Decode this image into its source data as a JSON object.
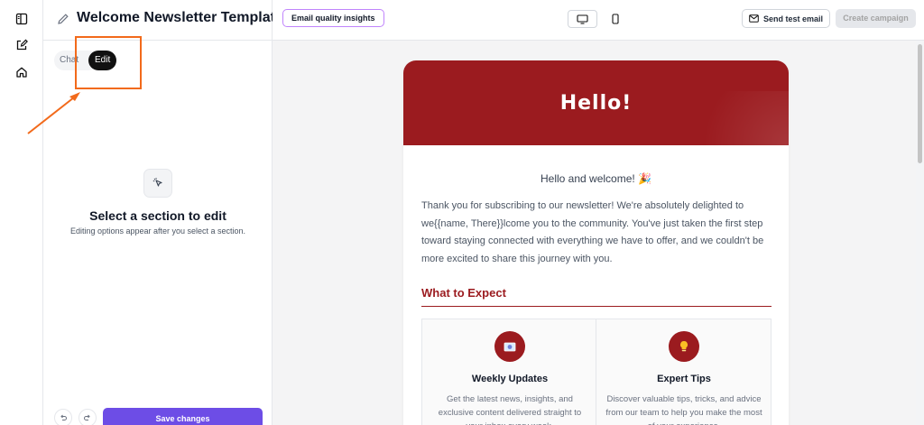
{
  "sidebar_rail": {
    "icons": [
      "panel-icon",
      "edit-document-icon",
      "home-icon"
    ]
  },
  "panel": {
    "title": "Welcome Newsletter Template",
    "mode_chat_label": "Chat",
    "mode_edit_label": "Edit",
    "empty_state_title": "Select a section to edit",
    "empty_state_subtitle": "Editing options appear after you select a section.",
    "save_label": "Save changes"
  },
  "topbar": {
    "insights_label": "Email quality insights",
    "send_test_label": "Send test email",
    "create_campaign_label": "Create campaign"
  },
  "email": {
    "hero_title": "Hello!",
    "greeting": "Hello and welcome! 🎉",
    "intro": "Thank you for subscribing to our newsletter! We're absolutely delighted to we{{name, There}}lcome you to the community. You've just taken the first step toward staying connected with everything we have to offer, and we couldn't be more excited to share this journey with you.",
    "section_title": "What to Expect",
    "cards": [
      {
        "title": "Weekly Updates",
        "text": "Get the latest news, insights, and exclusive content delivered straight to your inbox every week.",
        "icon": "envelope-icon"
      },
      {
        "title": "Expert Tips",
        "text": "Discover valuable tips, tricks, and advice from our team to help you make the most of your experience.",
        "icon": "lightbulb-icon"
      }
    ]
  },
  "colors": {
    "brand_red": "#9b1b1f",
    "primary_purple": "#6d4de6",
    "annotation_orange": "#f26a1b"
  }
}
